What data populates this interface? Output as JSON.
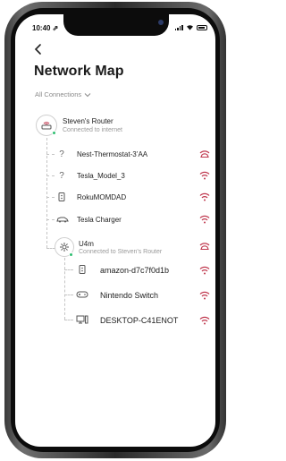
{
  "status_bar": {
    "time": "10:40 ⇗"
  },
  "nav": {
    "back_label": "<"
  },
  "page": {
    "title": "Network Map"
  },
  "filter": {
    "label": "All Connections"
  },
  "router": {
    "name": "Steven's Router",
    "status": "Connected to internet"
  },
  "devices": [
    {
      "name": "Nest-Thermostat-3’AA",
      "icon": "question-icon",
      "signal": "weak"
    },
    {
      "name": "Tesla_Model_3",
      "icon": "question-icon",
      "signal": "good"
    },
    {
      "name": "RokuMOMDAD",
      "icon": "device-icon",
      "signal": "good"
    },
    {
      "name": "Tesla Charger",
      "icon": "car-icon",
      "signal": "good"
    }
  ],
  "extender": {
    "name": "U4m",
    "status": "Connected to Steven's Router",
    "signal": "weak"
  },
  "extender_devices": [
    {
      "name": "amazon-d7c7f0d1b",
      "icon": "device-icon",
      "signal": "good"
    },
    {
      "name": "Nintendo Switch",
      "icon": "gamepad-icon",
      "signal": "good"
    },
    {
      "name": "DESKTOP-C41ENOT",
      "icon": "desktop-icon",
      "signal": "good"
    }
  ],
  "colors": {
    "accent_signal": "#c0394f",
    "online": "#2fbf71"
  }
}
